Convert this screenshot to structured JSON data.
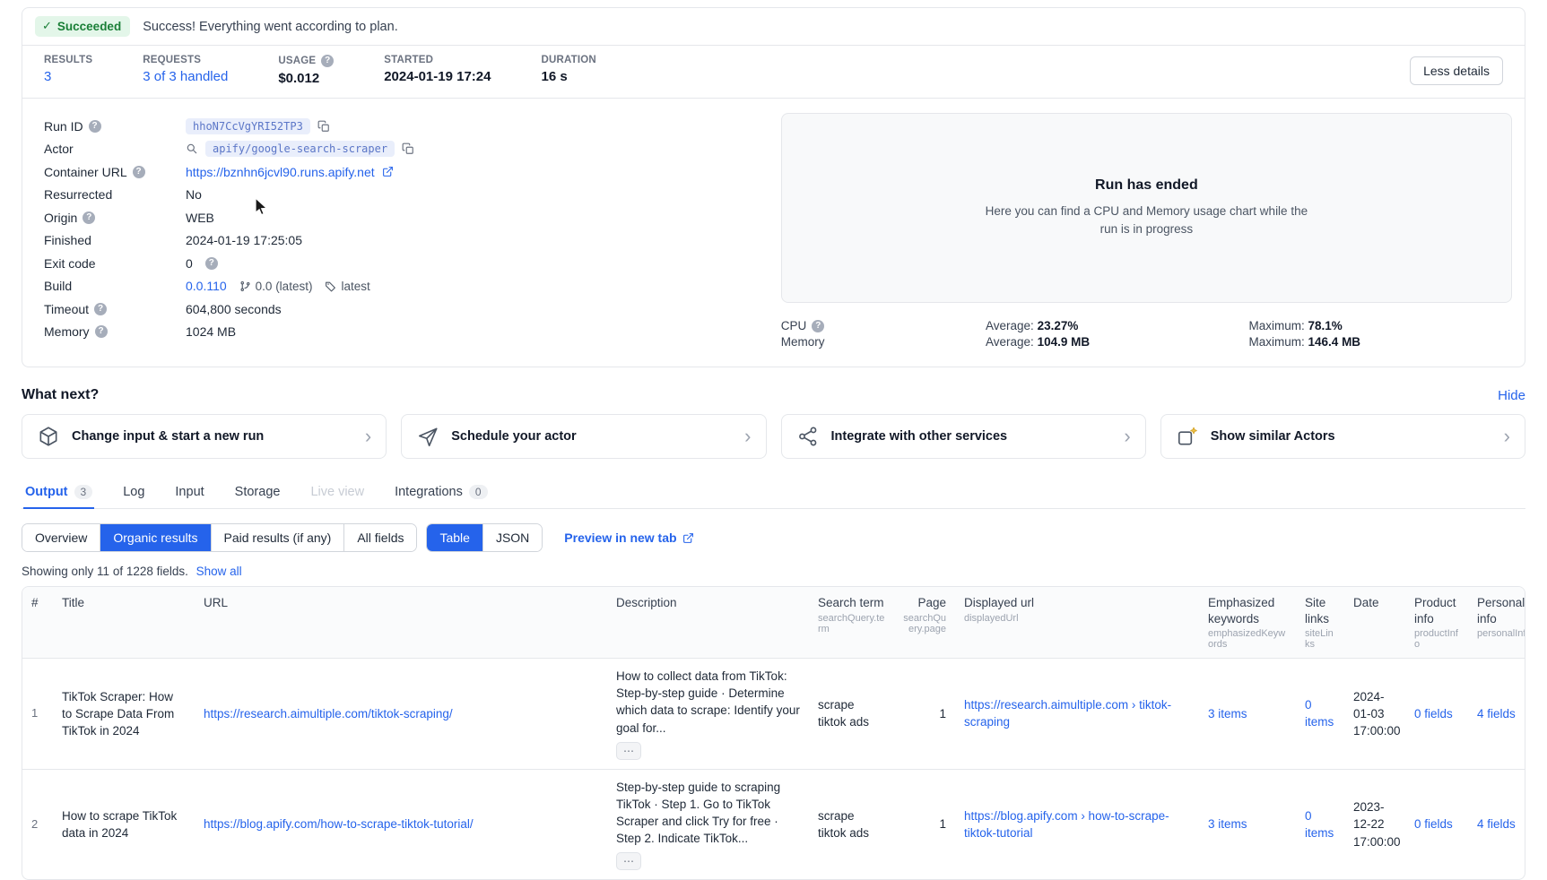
{
  "colors": {
    "accent": "#2563eb",
    "link": "#2563eb",
    "success-bg": "#e3f6e9",
    "success-text": "#1a7f37"
  },
  "icons": {
    "help": "?",
    "chevron": "›",
    "more": "⋯",
    "check": "✓"
  },
  "banner": {
    "badge": "Succeeded",
    "message": "Success! Everything went according to plan."
  },
  "stats": {
    "results": {
      "label": "RESULTS",
      "value": "3"
    },
    "requests": {
      "label": "REQUESTS",
      "value": "3 of 3 handled"
    },
    "usage": {
      "label": "USAGE",
      "value": "$0.012"
    },
    "started": {
      "label": "STARTED",
      "value": "2024-01-19 17:24"
    },
    "duration": {
      "label": "DURATION",
      "value": "16 s"
    }
  },
  "less_details_label": "Less details",
  "details": {
    "run_id": {
      "label": "Run ID",
      "value": "hhoN7CcVgYRI52TP3"
    },
    "actor": {
      "label": "Actor",
      "value": "apify/google-search-scraper"
    },
    "container_url": {
      "label": "Container URL",
      "value": "https://bznhn6jcvl90.runs.apify.net"
    },
    "resurrected": {
      "label": "Resurrected",
      "value": "No"
    },
    "origin": {
      "label": "Origin",
      "value": "WEB"
    },
    "finished": {
      "label": "Finished",
      "value": "2024-01-19 17:25:05"
    },
    "exit_code": {
      "label": "Exit code",
      "value": "0"
    },
    "build": {
      "label": "Build",
      "version": "0.0.110",
      "latest": "0.0 (latest)",
      "tag": "latest"
    },
    "timeout": {
      "label": "Timeout",
      "value": "604,800 seconds"
    },
    "memory": {
      "label": "Memory",
      "value": "1024 MB"
    }
  },
  "chart_panel": {
    "title": "Run has ended",
    "subtitle": "Here you can find a CPU and Memory usage chart while the run is in progress"
  },
  "usage_stats": {
    "cpu_label": "CPU",
    "memory_label": "Memory",
    "cpu_avg_label": "Average:",
    "cpu_avg": "23.27%",
    "cpu_max_label": "Maximum:",
    "cpu_max": "78.1%",
    "mem_avg_label": "Average:",
    "mem_avg": "104.9 MB",
    "mem_max_label": "Maximum:",
    "mem_max": "146.4 MB"
  },
  "what_next": {
    "title": "What next?",
    "hide": "Hide",
    "cards": [
      {
        "label": "Change input & start a new run"
      },
      {
        "label": "Schedule your actor"
      },
      {
        "label": "Integrate with other services"
      },
      {
        "label": "Show similar Actors"
      }
    ]
  },
  "tabs": [
    {
      "label": "Output",
      "badge": "3"
    },
    {
      "label": "Log"
    },
    {
      "label": "Input"
    },
    {
      "label": "Storage"
    },
    {
      "label": "Live view"
    },
    {
      "label": "Integrations",
      "badge": "0"
    }
  ],
  "result_controls": {
    "view_tabs": [
      "Overview",
      "Organic results",
      "Paid results (if any)",
      "All fields"
    ],
    "format_tabs": [
      "Table",
      "JSON"
    ],
    "preview_label": "Preview in new tab"
  },
  "fields_note": {
    "text": "Showing only 11 of 1228 fields.",
    "link": "Show all"
  },
  "table": {
    "columns": {
      "num": {
        "label": "#"
      },
      "title": {
        "label": "Title"
      },
      "url": {
        "label": "URL"
      },
      "description": {
        "label": "Description"
      },
      "search_term": {
        "label": "Search term",
        "sub": "searchQuery.term"
      },
      "page": {
        "label": "Page",
        "sub": "searchQuery.page"
      },
      "displayed_url": {
        "label": "Displayed url",
        "sub": "displayedUrl"
      },
      "emphasized": {
        "label": "Emphasized keywords",
        "sub": "emphasizedKeywords"
      },
      "site_links": {
        "label": "Site links",
        "sub": "siteLinks"
      },
      "date": {
        "label": "Date"
      },
      "product_info": {
        "label": "Product info",
        "sub": "productInfo"
      },
      "personal_info": {
        "label": "Personal info",
        "sub": "personalInfo"
      }
    },
    "rows": [
      {
        "num": "1",
        "title": "TikTok Scraper: How to Scrape Data From TikTok in 2024",
        "url": "https://research.aimultiple.com/tiktok-scraping/",
        "description": "How to collect data from TikTok: Step-by-step guide · Determine which data to scrape: Identify your goal for...",
        "search_term": "scrape tiktok ads",
        "page": "1",
        "displayed_url": "https://research.aimultiple.com › tiktok-scraping",
        "emphasized": "3 items",
        "site_links": "0 items",
        "date": "2024-01-03 17:00:00",
        "product_info": "0 fields",
        "personal_info": "4 fields"
      },
      {
        "num": "2",
        "title": "How to scrape TikTok data in 2024",
        "url": "https://blog.apify.com/how-to-scrape-tiktok-tutorial/",
        "description": "Step-by-step guide to scraping TikTok · Step 1. Go to TikTok Scraper and click Try for free · Step 2. Indicate TikTok...",
        "search_term": "scrape tiktok ads",
        "page": "1",
        "displayed_url": "https://blog.apify.com › how-to-scrape-tiktok-tutorial",
        "emphasized": "3 items",
        "site_links": "0 items",
        "date": "2023-12-22 17:00:00",
        "product_info": "0 fields",
        "personal_info": "4 fields"
      }
    ]
  }
}
